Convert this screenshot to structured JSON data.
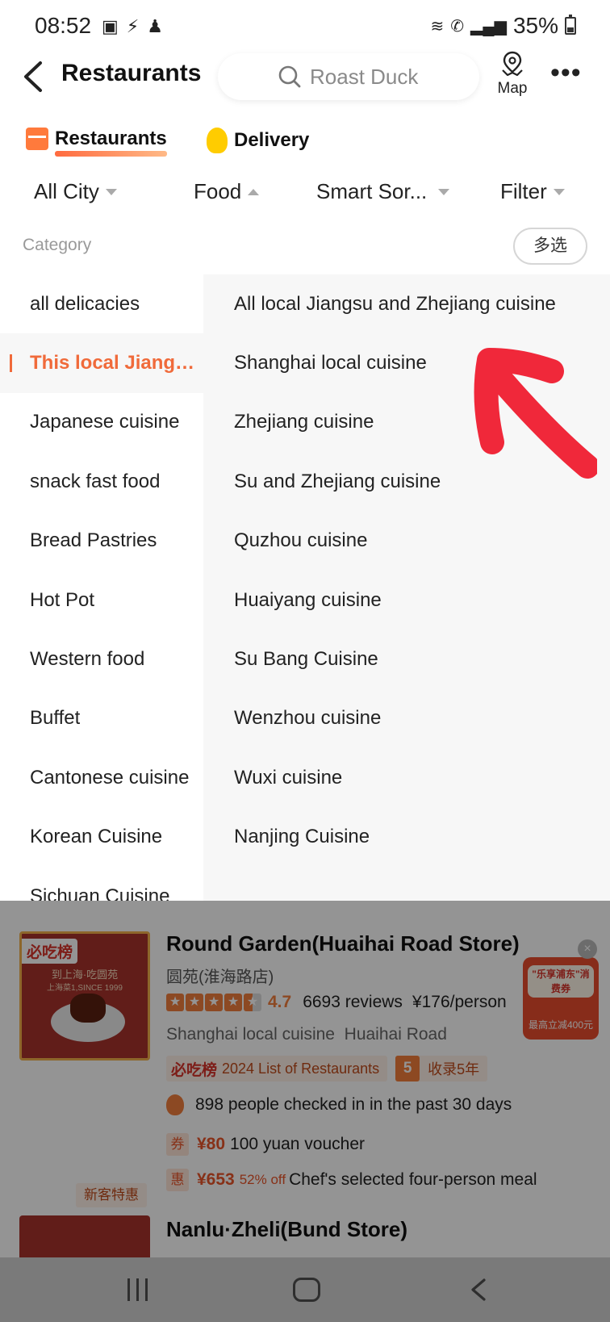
{
  "status_bar": {
    "time": "08:52",
    "battery": "35%",
    "left_icons": [
      "image-icon",
      "flash-icon",
      "profile-icon"
    ],
    "right_icons": [
      "wifi-calling-icon",
      "call-icon",
      "signal-icon",
      "battery-icon"
    ]
  },
  "header": {
    "title": "Restaurants",
    "search_placeholder": "Roast Duck",
    "map_label": "Map",
    "more_label": "•••"
  },
  "tabs": [
    {
      "label": "Restaurants",
      "active": true
    },
    {
      "label": "Delivery",
      "active": false
    }
  ],
  "filters": {
    "city": "All City",
    "food": "Food",
    "sort": "Smart Sor...",
    "filter": "Filter"
  },
  "category": {
    "label": "Category",
    "multi_select": "多选"
  },
  "left_categories": [
    "all delicacies",
    "This local Jiangs...",
    "Japanese cuisine",
    "snack fast food",
    "Bread Pastries",
    "Hot Pot",
    "Western food",
    "Buffet",
    "Cantonese cuisine",
    "Korean Cuisine",
    "Sichuan Cuisine"
  ],
  "right_categories": [
    "All local Jiangsu and Zhejiang cuisine",
    "Shanghai local cuisine",
    "Zhejiang cuisine",
    "Su and Zhejiang cuisine",
    "Quzhou cuisine",
    "Huaiyang cuisine",
    "Su Bang Cuisine",
    "Wenzhou cuisine",
    "Wuxi cuisine",
    "Nanjing Cuisine"
  ],
  "results": [
    {
      "name": "Round Garden(Huaihai Road Store)",
      "name_cn": "圆苑(淮海路店)",
      "thumb_badge": "必吃榜",
      "thumb_line1": "到上海·吃圆苑",
      "thumb_line2": "上海菜1,SINCE 1999",
      "rating": "4.7",
      "reviews": "6693 reviews",
      "price": "¥176/person",
      "cuisine": "Shanghai local cuisine",
      "area": "Huaihai Road",
      "list_logo": "必吃榜",
      "list_tag": "2024 List of Restaurants",
      "years_num": "5",
      "years_text": "收录5年",
      "checkin": "898 people checked in in the past 30 days",
      "voucher_icon": "券",
      "voucher_price": "¥80",
      "voucher_text": "100 yuan voucher",
      "meal_icon": "惠",
      "meal_price": "¥653",
      "meal_off": "52% off",
      "meal_text": "Chef's selected four-person meal",
      "new_customer": "新客特惠",
      "promo_top": "\"乐享浦东\"消费券",
      "promo_bottom": "最高立减400元"
    },
    {
      "name": "Nanlu·Zheli(Bund Store)"
    }
  ],
  "colors": {
    "accent": "#f06a3a",
    "annotation": "#f0283a"
  }
}
